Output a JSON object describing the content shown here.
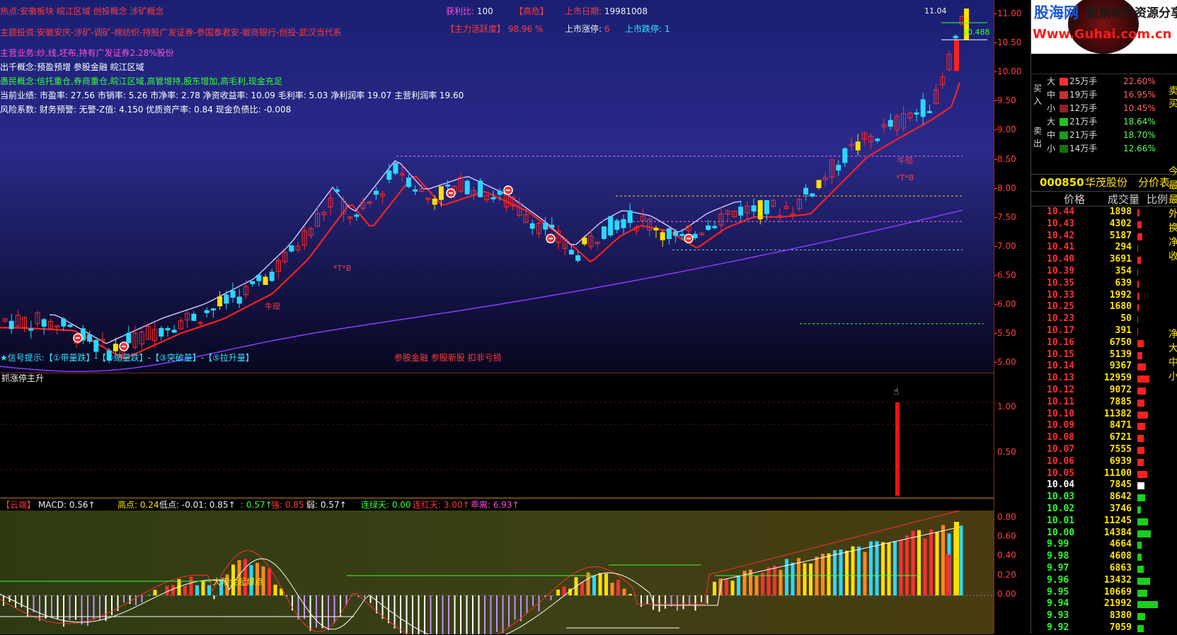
{
  "watermark": {
    "brand": "股海网",
    "tagline": "股票软件资源分享",
    "url": "Www.Guhai.com.cn"
  },
  "main": {
    "info_lines": [
      "热点:安徽板块 皖江区域 创投概念 涉矿概念",
      "主题投资:安徽安庆-涉矿-调矿-棉纺织-持股广发证券-参国泰君安-徽商银行-创投-武汉当代系",
      "主营业务:纱,线,坯布,持有广发证券2.28%股份",
      "出千概念:预盈预增 参股金融 皖江区域",
      "愚民概念:信托重仓,券商重仓,皖江区域,高管增持,股东增加,高毛利,现金充足",
      "当前业绩: 市盈率: 27.56 市销率: 5.26 市净率: 2.78 净资收益率: 10.09 毛利率: 5.03 净利润率 19.07 主营利润率 19.60",
      "风险系数: 财务预警: 无警-Z值: 4.150 优质资产率: 0.84 现金负债比: -0.008"
    ],
    "top_stats": {
      "profit_label": "获利比:",
      "profit_value": "100",
      "level": "【高危】",
      "listing_label": "上市日期:",
      "listing_date": "19981008",
      "activity_label": "【主力活跃度】",
      "activity_value": "98.96 %",
      "limit_up_label": "上市涨停:",
      "limit_up_value": "6",
      "limit_down_label": "上市跌停:",
      "limit_down_value": "1"
    },
    "signal_legend": "★信号提示:【①带量跌】-【②缩量跌】-【③突破量】-【⑤拉升量】",
    "center_note": "参股金融 参股新股 扣非亏损",
    "high_label": "11.04",
    "ma_label": "10.488",
    "annotations": [
      "*T*B",
      "*T*B",
      "牛现",
      "牛现"
    ]
  },
  "sub": {
    "title": "抓涨停主升",
    "levels": [
      "1.00",
      "0.50"
    ]
  },
  "macd": {
    "header": [
      {
        "t": "【云端】",
        "c": "red"
      },
      {
        "t": "MACD: 0.56↑",
        "c": "wht"
      },
      {
        "t": "高点: 0.24",
        "c": "yel"
      },
      {
        "t": "低点: -0.01",
        "c": "wht"
      },
      {
        "t": ": 0.85↑",
        "c": "wht"
      },
      {
        "t": ": 0.57↑",
        "c": "grn"
      },
      {
        "t": "强: 0.85↑",
        "c": "red"
      },
      {
        "t": "弱: 0.57↑",
        "c": "wht"
      },
      {
        "t": "连绿天: 0.00",
        "c": "grn"
      },
      {
        "t": "连红天: 3.00↑",
        "c": "red"
      },
      {
        "t": "乖离: 6.93↑",
        "c": "mag"
      }
    ],
    "note": "大阳金起爆点",
    "levels": [
      "0.80",
      "0.60",
      "0.40",
      "0.20",
      "0.00"
    ]
  },
  "axis": {
    "price_levels": [
      "11.00",
      "10.50",
      "10.00",
      "9.50",
      "9.00",
      "8.50",
      "8.00",
      "7.50",
      "7.00",
      "6.50",
      "6.00",
      "5.50",
      "5.00"
    ]
  },
  "panel": {
    "side_buy": "买入",
    "side_sell": "卖出",
    "edge_labels": [
      "卖",
      "买",
      "今",
      "最",
      "最",
      "外",
      "换",
      "净",
      "收",
      "净",
      "大",
      "中",
      "小"
    ],
    "orders": [
      {
        "side": "买",
        "size": "大",
        "amount": "25万手",
        "pct": "22.60%",
        "color": "#ff3030"
      },
      {
        "side": "买",
        "size": "中",
        "amount": "19万手",
        "pct": "16.95%",
        "color": "#c0303a"
      },
      {
        "side": "买",
        "size": "小",
        "amount": "12万手",
        "pct": "10.45%",
        "color": "#8a2228"
      },
      {
        "side": "卖",
        "size": "大",
        "amount": "21万手",
        "pct": "18.64%",
        "color": "#22c422"
      },
      {
        "side": "卖",
        "size": "中",
        "amount": "21万手",
        "pct": "18.70%",
        "color": "#1c9a1c"
      },
      {
        "side": "卖",
        "size": "小",
        "amount": "14万手",
        "pct": "12.66%",
        "color": "#146e14"
      }
    ],
    "stock_code": "000850",
    "stock_name": "华茂股份",
    "table_title": "分价表",
    "col_price": "价格",
    "col_volume": "成交量",
    "col_ratio": "比例",
    "rows": [
      {
        "price": "10.44",
        "vol": "1898",
        "bar": 3,
        "c": "red"
      },
      {
        "price": "10.43",
        "vol": "4302",
        "bar": 6,
        "c": "red"
      },
      {
        "price": "10.42",
        "vol": "5187",
        "bar": 7,
        "c": "red"
      },
      {
        "price": "10.41",
        "vol": "294",
        "bar": 1,
        "c": "red"
      },
      {
        "price": "10.40",
        "vol": "3691",
        "bar": 5,
        "c": "red"
      },
      {
        "price": "10.39",
        "vol": "354",
        "bar": 1,
        "c": "red"
      },
      {
        "price": "10.35",
        "vol": "639",
        "bar": 2,
        "c": "red"
      },
      {
        "price": "10.33",
        "vol": "1992",
        "bar": 3,
        "c": "red"
      },
      {
        "price": "10.25",
        "vol": "1680",
        "bar": 2,
        "c": "red"
      },
      {
        "price": "10.23",
        "vol": "50",
        "bar": 1,
        "c": "red"
      },
      {
        "price": "10.17",
        "vol": "391",
        "bar": 1,
        "c": "red"
      },
      {
        "price": "10.16",
        "vol": "6750",
        "bar": 9,
        "c": "red"
      },
      {
        "price": "10.15",
        "vol": "5139",
        "bar": 7,
        "c": "red"
      },
      {
        "price": "10.14",
        "vol": "9367",
        "bar": 12,
        "c": "red"
      },
      {
        "price": "10.13",
        "vol": "12959",
        "bar": 17,
        "c": "red"
      },
      {
        "price": "10.12",
        "vol": "9072",
        "bar": 12,
        "c": "red"
      },
      {
        "price": "10.11",
        "vol": "7885",
        "bar": 10,
        "c": "red"
      },
      {
        "price": "10.10",
        "vol": "11382",
        "bar": 15,
        "c": "red"
      },
      {
        "price": "10.09",
        "vol": "8471",
        "bar": 11,
        "c": "red"
      },
      {
        "price": "10.08",
        "vol": "6721",
        "bar": 9,
        "c": "red"
      },
      {
        "price": "10.07",
        "vol": "7555",
        "bar": 10,
        "c": "red"
      },
      {
        "price": "10.06",
        "vol": "6939",
        "bar": 9,
        "c": "red"
      },
      {
        "price": "10.05",
        "vol": "11100",
        "bar": 14,
        "c": "red"
      },
      {
        "price": "10.04",
        "vol": "7845",
        "bar": 10,
        "c": "wht"
      },
      {
        "price": "10.03",
        "vol": "8642",
        "bar": 11,
        "c": "grn"
      },
      {
        "price": "10.02",
        "vol": "3746",
        "bar": 5,
        "c": "grn"
      },
      {
        "price": "10.01",
        "vol": "11245",
        "bar": 15,
        "c": "grn"
      },
      {
        "price": "10.00",
        "vol": "14384",
        "bar": 19,
        "c": "grn"
      },
      {
        "price": "9.99",
        "vol": "4664",
        "bar": 6,
        "c": "grn"
      },
      {
        "price": "9.98",
        "vol": "4608",
        "bar": 6,
        "c": "grn"
      },
      {
        "price": "9.97",
        "vol": "6863",
        "bar": 9,
        "c": "grn"
      },
      {
        "price": "9.96",
        "vol": "13432",
        "bar": 18,
        "c": "grn"
      },
      {
        "price": "9.95",
        "vol": "10669",
        "bar": 14,
        "c": "grn"
      },
      {
        "price": "9.94",
        "vol": "21992",
        "bar": 29,
        "c": "grn"
      },
      {
        "price": "9.93",
        "vol": "8380",
        "bar": 11,
        "c": "grn"
      },
      {
        "price": "9.92",
        "vol": "7059",
        "bar": 9,
        "c": "grn"
      }
    ]
  }
}
